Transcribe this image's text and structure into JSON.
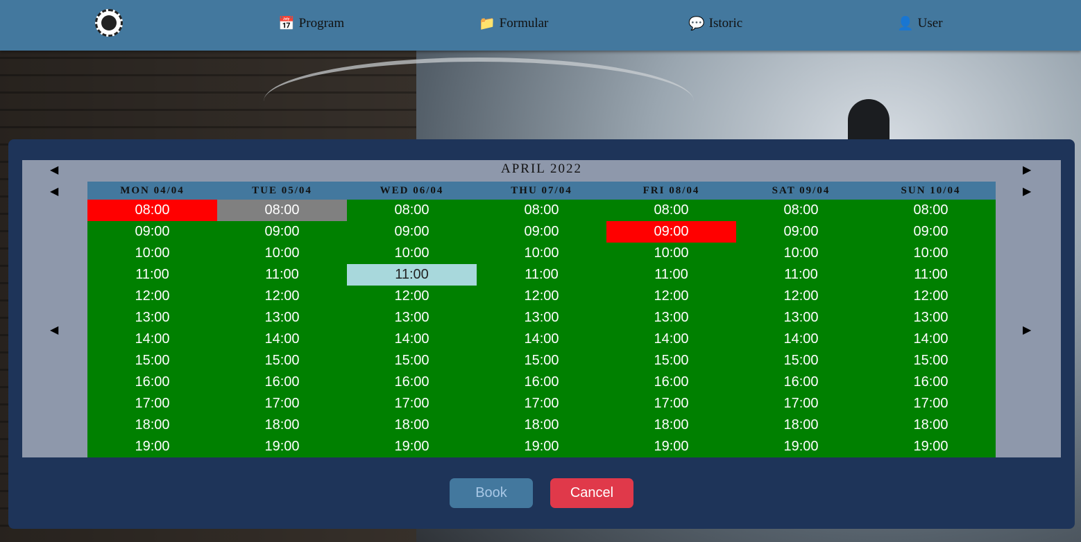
{
  "nav": {
    "logo_icon": "club-logo-icon",
    "items": [
      {
        "label": "Program",
        "icon": "calendar-icon"
      },
      {
        "label": "Formular",
        "icon": "folder-icon"
      },
      {
        "label": "Istoric",
        "icon": "chat-bubbles-icon"
      },
      {
        "label": "User",
        "icon": "user-icon"
      }
    ]
  },
  "calendar": {
    "month_label": "APRIL 2022",
    "prev_month": "◀",
    "next_month": "▶",
    "prev_week": "◀",
    "next_week": "▶",
    "prev_day": "◀",
    "next_day": "▶",
    "days": [
      {
        "label": "MON 04/04"
      },
      {
        "label": "TUE 05/04"
      },
      {
        "label": "WED 06/04"
      },
      {
        "label": "THU 07/04"
      },
      {
        "label": "FRI 08/04"
      },
      {
        "label": "SAT 09/04"
      },
      {
        "label": "SUN 10/04"
      }
    ],
    "times": [
      "08:00",
      "09:00",
      "10:00",
      "11:00",
      "12:00",
      "13:00",
      "14:00",
      "15:00",
      "16:00",
      "17:00",
      "18:00",
      "19:00"
    ],
    "slot_states": {
      "MON 04/04 08:00": "booked",
      "TUE 05/04 08:00": "pending",
      "WED 06/04 11:00": "selected",
      "FRI 08/04 09:00": "booked"
    },
    "colors": {
      "available": "#008000",
      "booked": "#ff0000",
      "pending": "#808080",
      "selected": "#a8d8dc"
    }
  },
  "actions": {
    "book_label": "Book",
    "cancel_label": "Cancel"
  }
}
